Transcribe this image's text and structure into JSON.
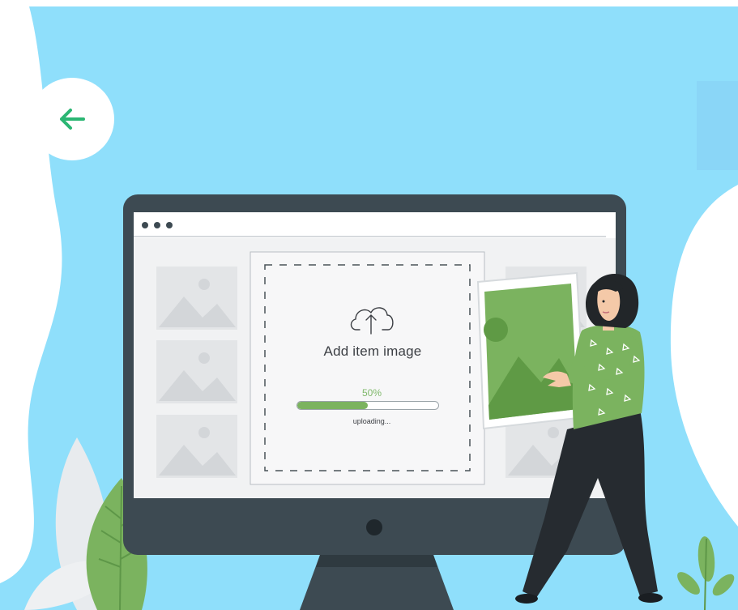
{
  "navigation": {
    "back_icon": "arrow-left-icon",
    "back_color": "#2bb673"
  },
  "browser": {
    "window_controls_icon": "three-dots-icon"
  },
  "upload": {
    "icon": "cloud-upload-icon",
    "title": "Add item image",
    "progress_label": "50%",
    "progress_value": 0.5,
    "status": "uploading..."
  },
  "colors": {
    "sky": "#8fdffb",
    "monitor": "#3d4a52",
    "accent_green": "#7bb35f",
    "text_dark": "#3c3f44"
  }
}
